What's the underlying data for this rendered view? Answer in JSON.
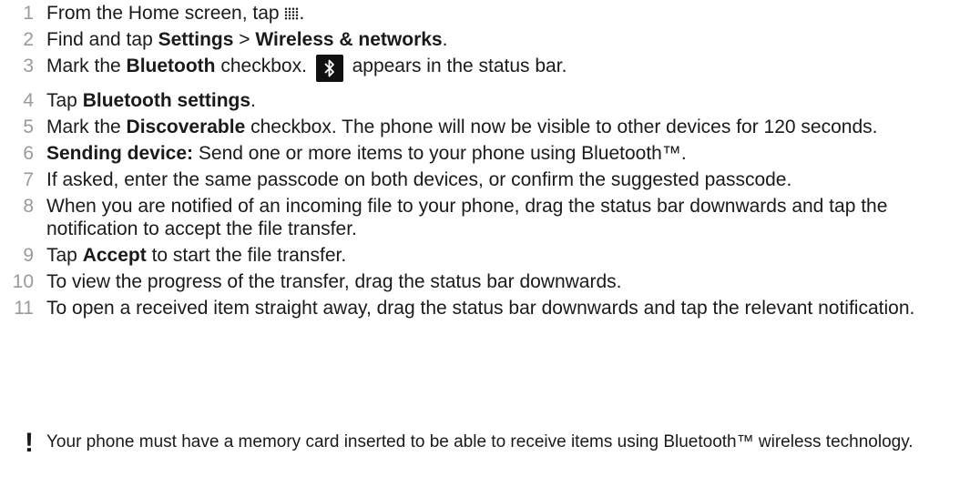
{
  "steps": [
    {
      "n": "1",
      "t1": "From the Home screen, tap ",
      "t2": "."
    },
    {
      "n": "2",
      "t1": "Find and tap ",
      "b1": "Settings",
      "t2": " > ",
      "b2": "Wireless & networks",
      "t3": "."
    },
    {
      "n": "3",
      "t1": "Mark the ",
      "b1": "Bluetooth",
      "t2": " checkbox. ",
      "t3": " appears in the status bar."
    },
    {
      "n": "4",
      "t1": "Tap ",
      "b1": "Bluetooth settings",
      "t2": "."
    },
    {
      "n": "5",
      "t1": "Mark the ",
      "b1": "Discoverable",
      "t2": " checkbox. The phone will now be visible to other devices for 120 seconds."
    },
    {
      "n": "6",
      "b1": "Sending device:",
      "t1": " Send one or more items to your phone using Bluetooth™."
    },
    {
      "n": "7",
      "t1": "If asked, enter the same passcode on both devices, or confirm the suggested passcode."
    },
    {
      "n": "8",
      "t1": "When you are notified of an incoming file to your phone, drag the status bar downwards and tap the notification to accept the file transfer."
    },
    {
      "n": "9",
      "t1": "Tap ",
      "b1": "Accept",
      "t2": " to start the file transfer."
    },
    {
      "n": "10",
      "t1": "To view the progress of the transfer, drag the status bar downwards."
    },
    {
      "n": "11",
      "t1": "To open a received item straight away, drag the status bar downwards and tap the relevant notification."
    }
  ],
  "note": {
    "icon": "!",
    "text": "Your phone must have a memory card inserted to be able to receive items using Bluetooth™ wireless technology."
  },
  "icons": {
    "apps": "apps-grid-icon",
    "bluetooth": "bluetooth-icon",
    "note": "exclamation-icon"
  }
}
